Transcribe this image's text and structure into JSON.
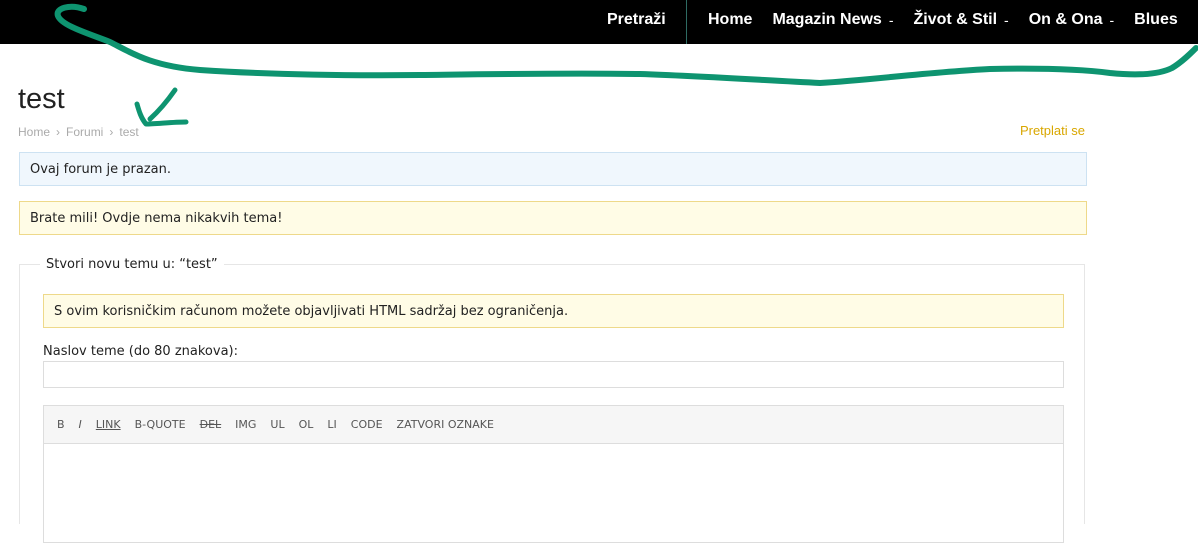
{
  "nav": {
    "search_label": "Pretraži",
    "items": [
      {
        "label": "Home",
        "has_submenu": false
      },
      {
        "label": "Magazin News",
        "has_submenu": true
      },
      {
        "label": "Život & Stil",
        "has_submenu": true
      },
      {
        "label": "On & Ona",
        "has_submenu": true
      },
      {
        "label": "Blues",
        "has_submenu": false
      }
    ],
    "submenu_caret": "-"
  },
  "page": {
    "title": "test",
    "breadcrumb": [
      "Home",
      "Forumi",
      "test"
    ],
    "breadcrumb_separator": "›",
    "subscribe_label": "Pretplati se"
  },
  "notices": {
    "info": "Ovaj forum je prazan.",
    "empty": "Brate mili! Ovdje nema nikakvih tema!"
  },
  "new_topic": {
    "legend": "Stvori novu temu u: “test”",
    "html_notice": "S ovim korisničkim računom možete objavljivati HTML sadržaj bez ograničenja.",
    "title_label": "Naslov teme (do 80 znakova):",
    "title_value": "",
    "toolbar": [
      "B",
      "I",
      "LINK",
      "B-QUOTE",
      "DEL",
      "IMG",
      "UL",
      "OL",
      "LI",
      "CODE",
      "ZATVORI OZNAKE"
    ],
    "content_value": ""
  },
  "colors": {
    "topbar": "#000000",
    "accent_subscribe": "#d9a700",
    "annotation_stroke": "#0e9470",
    "info_bg": "#f0f7fd",
    "warning_bg": "#fffce6"
  },
  "annotations": [
    "underline-stroke",
    "arrow-icon"
  ]
}
